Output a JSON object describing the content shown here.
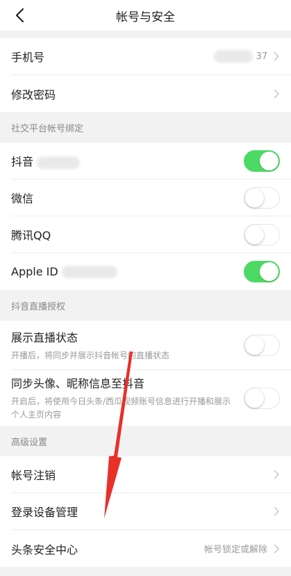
{
  "nav": {
    "title": "帐号与安全"
  },
  "account_group": {
    "phone_label": "手机号",
    "phone_value": "37",
    "password_label": "修改密码"
  },
  "social": {
    "header": "社交平台帐号绑定",
    "items": [
      {
        "label": "抖音",
        "on": true
      },
      {
        "label": "微信",
        "on": false
      },
      {
        "label": "腾讯QQ",
        "on": false
      },
      {
        "label": "Apple ID",
        "on": true
      }
    ]
  },
  "live": {
    "header": "抖音直播授权",
    "items": [
      {
        "label": "展示直播状态",
        "sub": "开播后，将同步并展示抖音帐号的直播状态",
        "on": false
      },
      {
        "label": "同步头像、昵称信息至抖音",
        "sub": "开启后，将使用今日头条/西瓜视频账号信息进行开播和展示个人主页内容",
        "on": false
      }
    ]
  },
  "advanced": {
    "header": "高级设置",
    "cancel_label": "帐号注销",
    "devices_label": "登录设备管理",
    "security_label": "头条安全中心",
    "security_value": "帐号锁定或解除"
  },
  "colors": {
    "toggle_on": "#4cd964",
    "arrow": "#e8302a"
  }
}
